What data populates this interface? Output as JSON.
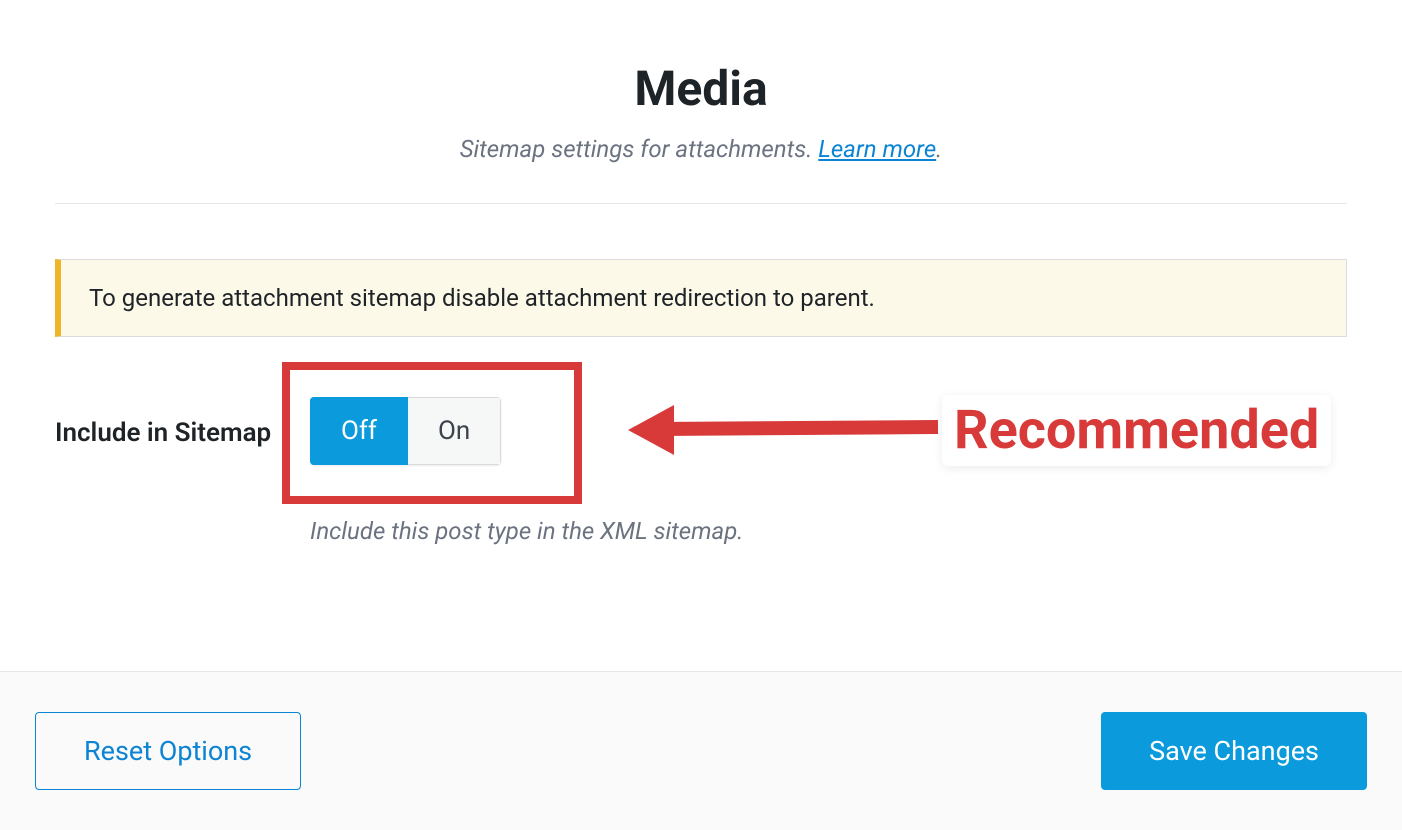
{
  "header": {
    "title": "Media",
    "subtitle_prefix": "Sitemap settings for attachments. ",
    "learn_more": "Learn more",
    "subtitle_period": "."
  },
  "notice": {
    "text": "To generate attachment sitemap disable attachment redirection to parent."
  },
  "setting": {
    "label": "Include in Sitemap",
    "toggle_off": "Off",
    "toggle_on": "On",
    "description": "Include this post type in the XML sitemap."
  },
  "annotation": {
    "recommended": "Recommended"
  },
  "footer": {
    "reset": "Reset Options",
    "save": "Save Changes"
  },
  "colors": {
    "accent_red": "#d83a3a",
    "accent_blue": "#0b9bdd",
    "link_blue": "#0b84d3",
    "notice_bg": "#fdf9e8",
    "notice_border": "#f0b429"
  }
}
